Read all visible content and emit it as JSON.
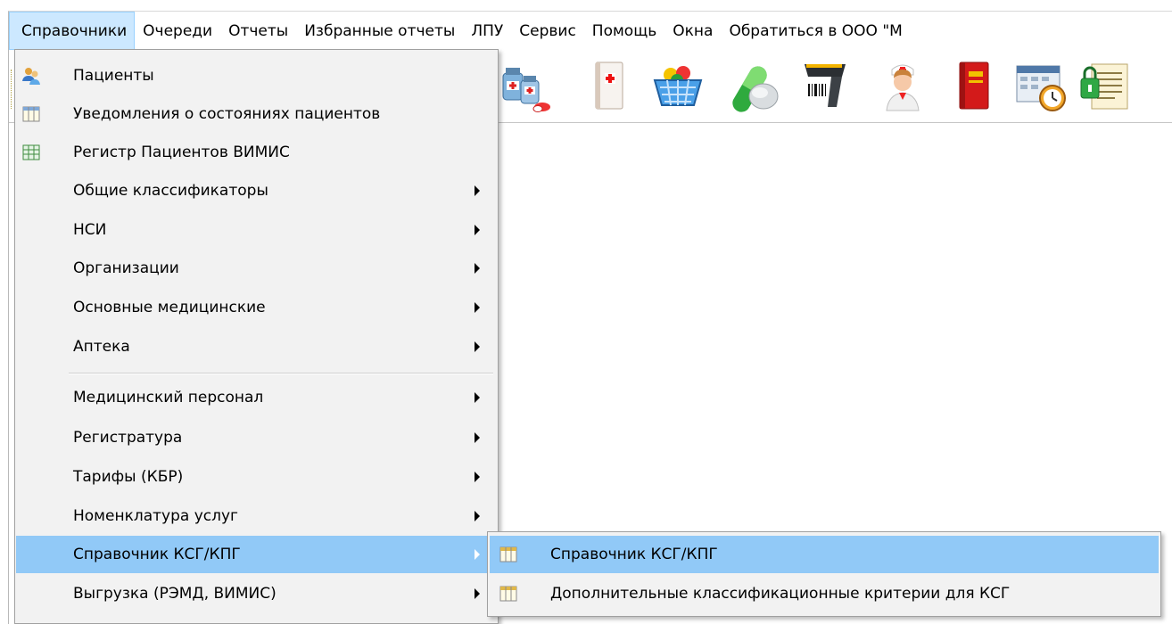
{
  "menubar": {
    "items": [
      {
        "label": "Справочники",
        "active": true
      },
      {
        "label": "Очереди"
      },
      {
        "label": "Отчеты"
      },
      {
        "label": "Избранные отчеты"
      },
      {
        "label": "ЛПУ"
      },
      {
        "label": "Сервис"
      },
      {
        "label": "Помощь"
      },
      {
        "label": "Окна"
      },
      {
        "label": "Обратиться в ООО \"М"
      }
    ]
  },
  "toolbar": {
    "icons": [
      "medicine-bottles-icon",
      "first-aid-book-icon",
      "pill-basket-icon",
      "capsules-icon",
      "barcode-scanner-icon",
      "nurse-icon",
      "red-book-icon",
      "schedule-clock-icon",
      "document-lock-icon"
    ]
  },
  "menu": {
    "items": [
      {
        "label": "Пациенты",
        "icon": "patients-icon"
      },
      {
        "label": "Уведомления о состояниях пациентов",
        "icon": "table-icon"
      },
      {
        "label": "Регистр Пациентов ВИМИС",
        "icon": "spreadsheet-icon"
      },
      {
        "label": "Общие классификаторы",
        "submenu": true
      },
      {
        "label": "НСИ",
        "submenu": true
      },
      {
        "label": "Организации",
        "submenu": true
      },
      {
        "label": "Основные медицинские",
        "submenu": true
      },
      {
        "label": "Аптека",
        "submenu": true
      },
      {
        "label": "Медицинский персонал",
        "submenu": true
      },
      {
        "label": "Регистратура",
        "submenu": true
      },
      {
        "label": "Тарифы (КБР)",
        "submenu": true
      },
      {
        "label": "Номенклатура услуг",
        "submenu": true
      },
      {
        "label": "Справочник КСГ/КПГ",
        "submenu": true,
        "highlighted": true
      },
      {
        "label": "Выгрузка (РЭМД, ВИМИС)",
        "submenu": true
      }
    ]
  },
  "submenu": {
    "items": [
      {
        "label": "Справочник КСГ/КПГ",
        "icon": "table-icon",
        "highlighted": true
      },
      {
        "label": "Дополнительные классификационные критерии для КСГ",
        "icon": "table-icon"
      }
    ]
  },
  "colors": {
    "menu_highlight": "#91c9f7",
    "menubar_active": "#cce8ff",
    "menu_background": "#f2f2f2"
  }
}
